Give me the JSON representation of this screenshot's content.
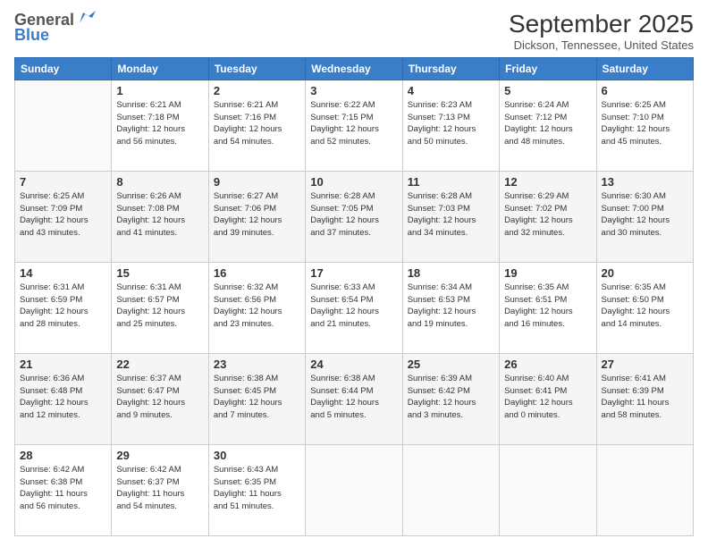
{
  "header": {
    "logo_general": "General",
    "logo_blue": "Blue",
    "month_title": "September 2025",
    "location": "Dickson, Tennessee, United States"
  },
  "days_of_week": [
    "Sunday",
    "Monday",
    "Tuesday",
    "Wednesday",
    "Thursday",
    "Friday",
    "Saturday"
  ],
  "weeks": [
    [
      {
        "day": "",
        "info": ""
      },
      {
        "day": "1",
        "info": "Sunrise: 6:21 AM\nSunset: 7:18 PM\nDaylight: 12 hours\nand 56 minutes."
      },
      {
        "day": "2",
        "info": "Sunrise: 6:21 AM\nSunset: 7:16 PM\nDaylight: 12 hours\nand 54 minutes."
      },
      {
        "day": "3",
        "info": "Sunrise: 6:22 AM\nSunset: 7:15 PM\nDaylight: 12 hours\nand 52 minutes."
      },
      {
        "day": "4",
        "info": "Sunrise: 6:23 AM\nSunset: 7:13 PM\nDaylight: 12 hours\nand 50 minutes."
      },
      {
        "day": "5",
        "info": "Sunrise: 6:24 AM\nSunset: 7:12 PM\nDaylight: 12 hours\nand 48 minutes."
      },
      {
        "day": "6",
        "info": "Sunrise: 6:25 AM\nSunset: 7:10 PM\nDaylight: 12 hours\nand 45 minutes."
      }
    ],
    [
      {
        "day": "7",
        "info": "Sunrise: 6:25 AM\nSunset: 7:09 PM\nDaylight: 12 hours\nand 43 minutes."
      },
      {
        "day": "8",
        "info": "Sunrise: 6:26 AM\nSunset: 7:08 PM\nDaylight: 12 hours\nand 41 minutes."
      },
      {
        "day": "9",
        "info": "Sunrise: 6:27 AM\nSunset: 7:06 PM\nDaylight: 12 hours\nand 39 minutes."
      },
      {
        "day": "10",
        "info": "Sunrise: 6:28 AM\nSunset: 7:05 PM\nDaylight: 12 hours\nand 37 minutes."
      },
      {
        "day": "11",
        "info": "Sunrise: 6:28 AM\nSunset: 7:03 PM\nDaylight: 12 hours\nand 34 minutes."
      },
      {
        "day": "12",
        "info": "Sunrise: 6:29 AM\nSunset: 7:02 PM\nDaylight: 12 hours\nand 32 minutes."
      },
      {
        "day": "13",
        "info": "Sunrise: 6:30 AM\nSunset: 7:00 PM\nDaylight: 12 hours\nand 30 minutes."
      }
    ],
    [
      {
        "day": "14",
        "info": "Sunrise: 6:31 AM\nSunset: 6:59 PM\nDaylight: 12 hours\nand 28 minutes."
      },
      {
        "day": "15",
        "info": "Sunrise: 6:31 AM\nSunset: 6:57 PM\nDaylight: 12 hours\nand 25 minutes."
      },
      {
        "day": "16",
        "info": "Sunrise: 6:32 AM\nSunset: 6:56 PM\nDaylight: 12 hours\nand 23 minutes."
      },
      {
        "day": "17",
        "info": "Sunrise: 6:33 AM\nSunset: 6:54 PM\nDaylight: 12 hours\nand 21 minutes."
      },
      {
        "day": "18",
        "info": "Sunrise: 6:34 AM\nSunset: 6:53 PM\nDaylight: 12 hours\nand 19 minutes."
      },
      {
        "day": "19",
        "info": "Sunrise: 6:35 AM\nSunset: 6:51 PM\nDaylight: 12 hours\nand 16 minutes."
      },
      {
        "day": "20",
        "info": "Sunrise: 6:35 AM\nSunset: 6:50 PM\nDaylight: 12 hours\nand 14 minutes."
      }
    ],
    [
      {
        "day": "21",
        "info": "Sunrise: 6:36 AM\nSunset: 6:48 PM\nDaylight: 12 hours\nand 12 minutes."
      },
      {
        "day": "22",
        "info": "Sunrise: 6:37 AM\nSunset: 6:47 PM\nDaylight: 12 hours\nand 9 minutes."
      },
      {
        "day": "23",
        "info": "Sunrise: 6:38 AM\nSunset: 6:45 PM\nDaylight: 12 hours\nand 7 minutes."
      },
      {
        "day": "24",
        "info": "Sunrise: 6:38 AM\nSunset: 6:44 PM\nDaylight: 12 hours\nand 5 minutes."
      },
      {
        "day": "25",
        "info": "Sunrise: 6:39 AM\nSunset: 6:42 PM\nDaylight: 12 hours\nand 3 minutes."
      },
      {
        "day": "26",
        "info": "Sunrise: 6:40 AM\nSunset: 6:41 PM\nDaylight: 12 hours\nand 0 minutes."
      },
      {
        "day": "27",
        "info": "Sunrise: 6:41 AM\nSunset: 6:39 PM\nDaylight: 11 hours\nand 58 minutes."
      }
    ],
    [
      {
        "day": "28",
        "info": "Sunrise: 6:42 AM\nSunset: 6:38 PM\nDaylight: 11 hours\nand 56 minutes."
      },
      {
        "day": "29",
        "info": "Sunrise: 6:42 AM\nSunset: 6:37 PM\nDaylight: 11 hours\nand 54 minutes."
      },
      {
        "day": "30",
        "info": "Sunrise: 6:43 AM\nSunset: 6:35 PM\nDaylight: 11 hours\nand 51 minutes."
      },
      {
        "day": "",
        "info": ""
      },
      {
        "day": "",
        "info": ""
      },
      {
        "day": "",
        "info": ""
      },
      {
        "day": "",
        "info": ""
      }
    ]
  ]
}
